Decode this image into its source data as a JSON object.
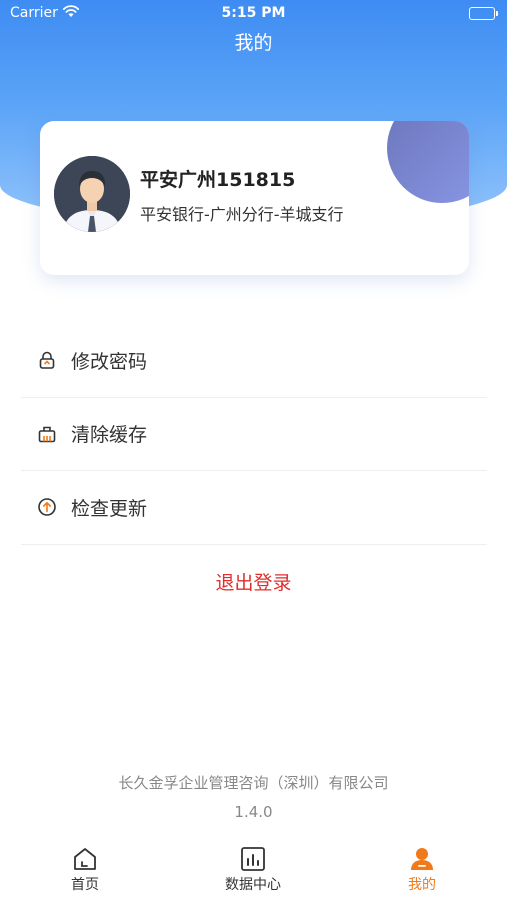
{
  "status_bar": {
    "carrier": "Carrier",
    "time": "5:15 PM"
  },
  "header": {
    "title": "我的"
  },
  "profile": {
    "name": "平安广州151815",
    "branch": "平安银行-广州分行-羊城支行"
  },
  "menu": {
    "items": [
      {
        "label": "修改密码",
        "icon": "lock-icon"
      },
      {
        "label": "清除缓存",
        "icon": "basket-icon"
      },
      {
        "label": "检查更新",
        "icon": "upload-circle-icon"
      }
    ],
    "logout_label": "退出登录"
  },
  "footer": {
    "company": "长久金孚企业管理咨询（深圳）有限公司",
    "version": "1.4.0"
  },
  "tabbar": {
    "tabs": [
      {
        "label": "首页",
        "icon": "home-icon"
      },
      {
        "label": "数据中心",
        "icon": "chart-icon"
      },
      {
        "label": "我的",
        "icon": "person-icon"
      }
    ],
    "active_index": 2
  },
  "colors": {
    "header_gradient_top": "#3e8cf3",
    "header_gradient_bottom": "#93c4fb",
    "logout": "#e02e2e",
    "tab_active": "#f07a1a"
  }
}
